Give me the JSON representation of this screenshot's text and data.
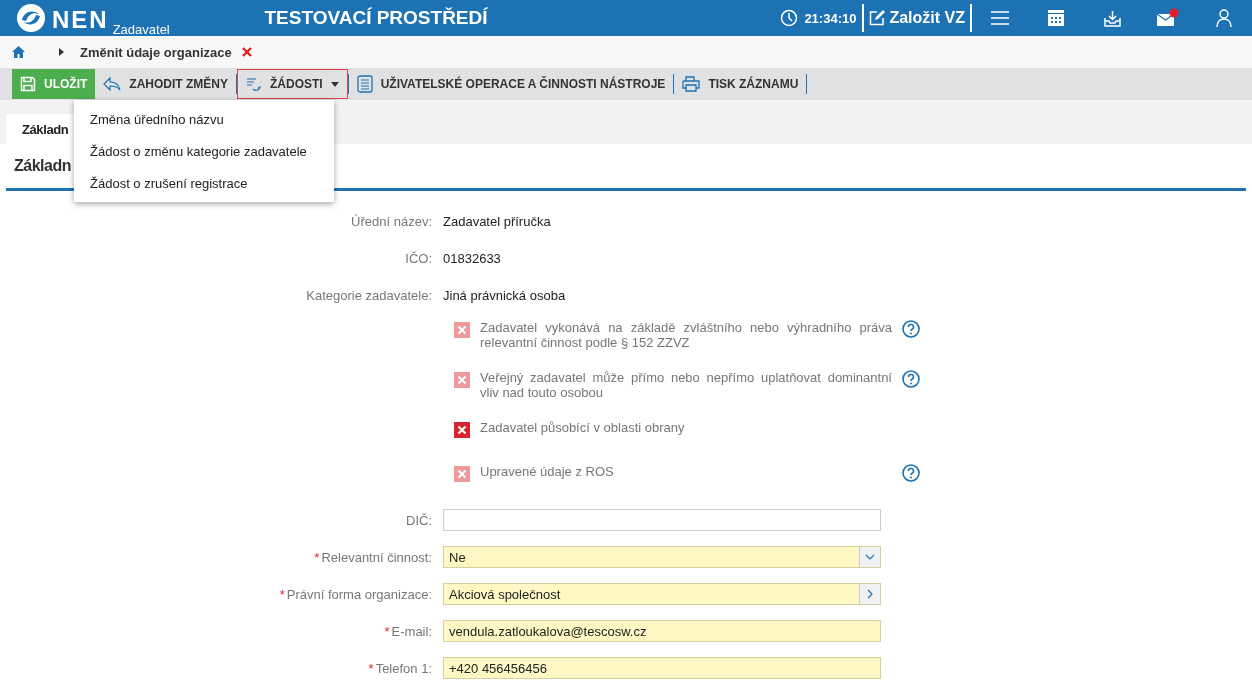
{
  "header": {
    "logo": "NEN",
    "logo_sub": "Zadavatel",
    "title": "TESTOVACÍ PROSTŘEDÍ",
    "time": "21:34:10",
    "create_button": "Založit VZ",
    "mail_unread": true
  },
  "breadcrumb": {
    "current": "Změnit údaje organizace"
  },
  "toolbar": [
    {
      "label": "ULOŽIT",
      "kind": "save",
      "selected": false
    },
    {
      "label": "ZAHODIT ZMĚNY",
      "kind": "discard",
      "selected": false
    },
    {
      "label": "ŽÁDOSTI",
      "kind": "dropdown",
      "selected": true
    },
    {
      "label": "UŽIVATELSKÉ OPERACE A ČINNOSTI NÁSTROJE",
      "kind": "list",
      "selected": false
    },
    {
      "label": "TISK ZÁZNAMU",
      "kind": "print",
      "selected": false
    }
  ],
  "dropdown_menu": [
    "Změna úředního názvu",
    "Žádost o změnu kategorie zadavatele",
    "Žádost o zrušení registrace"
  ],
  "tabs": [
    {
      "label": "Základn",
      "selected": true
    }
  ],
  "section_title": "Základn",
  "info_rows": [
    {
      "label": "Úřední název:",
      "value": "Zadavatel příručka"
    },
    {
      "label": "IČO:",
      "value": "01832633"
    },
    {
      "label": "Kategorie zadavatele:",
      "value": "Jiná právnická osoba"
    }
  ],
  "checkboxes": [
    {
      "label": "Zadavatel vykonává na základě zvláštního nebo výhradního práva relevantní činnost podle § 152 ZZVZ",
      "checked": false,
      "disabled": true,
      "help": true
    },
    {
      "label": "Veřejný zadavatel může přímo nebo nepřímo uplatňovat dominantní vliv nad touto osobou",
      "checked": false,
      "disabled": true,
      "help": true
    },
    {
      "label": "Zadavatel působící v oblasti obrany",
      "checked": false,
      "disabled": false,
      "help": false
    },
    {
      "label": "Upravené údaje z ROS",
      "checked": false,
      "disabled": true,
      "help": true
    }
  ],
  "fields": [
    {
      "label": "DIČ:",
      "kind": "text"
    },
    {
      "label": "Relevantní činnost:",
      "required_mark": "*",
      "kind": "select",
      "value": "Ne"
    },
    {
      "label": "Právní forma organizace:",
      "required_mark": "*",
      "kind": "picker",
      "value": "Akciová společnost"
    },
    {
      "label": "E-mail:",
      "required_mark": "*",
      "kind": "text",
      "value": "vendula.zatloukalova@tescosw.cz"
    },
    {
      "label": "Telefon 1:",
      "required_mark": "*",
      "kind": "text",
      "value": "+420 456456456"
    }
  ]
}
